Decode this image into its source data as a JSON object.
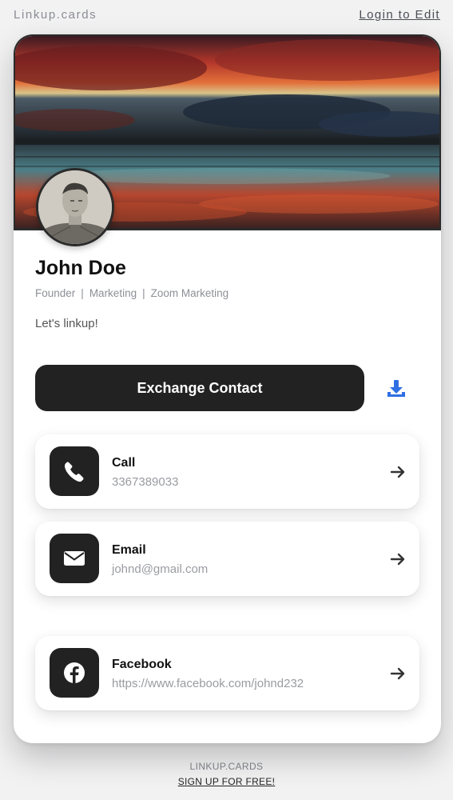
{
  "header": {
    "brand": "Linkup.cards",
    "login_label": "Login to Edit"
  },
  "profile": {
    "name": "John Doe",
    "roles": [
      "Founder",
      "Marketing",
      "Zoom Marketing"
    ],
    "bio": "Let's linkup!",
    "cover_image": "sunset-over-water-photo",
    "avatar_image": "engraved-portrait"
  },
  "actions": {
    "exchange_label": "Exchange Contact",
    "download_icon": "download-icon"
  },
  "links": [
    {
      "title": "Call",
      "value": "3367389033",
      "icon": "phone-icon"
    },
    {
      "title": "Email",
      "value": "johnd@gmail.com",
      "icon": "envelope-icon"
    },
    {
      "title": "Facebook",
      "value": "https://www.facebook.com/johnd232",
      "icon": "facebook-icon"
    }
  ],
  "footer": {
    "brand": "LINKUP.CARDS",
    "signup_label": "SIGN UP FOR FREE!"
  },
  "colors": {
    "button_dark": "#222222",
    "accent_blue": "#2f6fe4",
    "muted_text": "#9a9ca1",
    "page_bg": "#f2f2f3"
  }
}
